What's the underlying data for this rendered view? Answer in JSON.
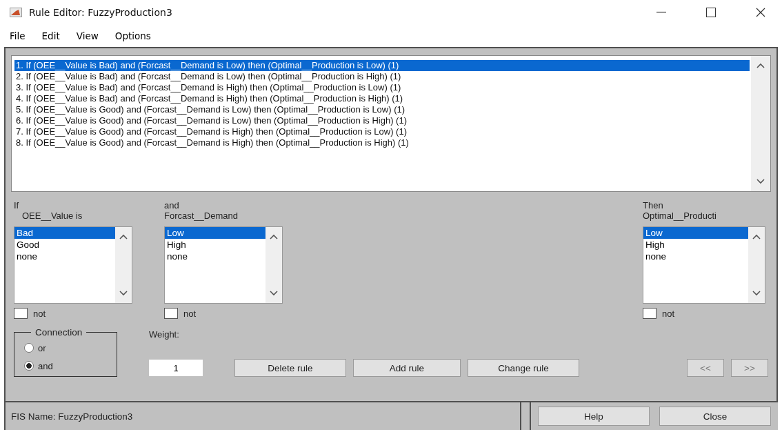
{
  "window": {
    "title": "Rule Editor: FuzzyProduction3"
  },
  "menu": [
    "File",
    "Edit",
    "View",
    "Options"
  ],
  "rules": [
    {
      "text": "1. If (OEE__Value is Bad) and (Forcast__Demand is Low) then (Optimal__Production is Low) (1)",
      "selected": true
    },
    {
      "text": "2. If (OEE__Value is Bad) and (Forcast__Demand is Low) then (Optimal__Production is High) (1)",
      "selected": false
    },
    {
      "text": "3. If (OEE__Value is Bad) and (Forcast__Demand is High) then (Optimal__Production is Low) (1)",
      "selected": false
    },
    {
      "text": "4. If (OEE__Value is Bad) and (Forcast__Demand is High) then (Optimal__Production is High) (1)",
      "selected": false
    },
    {
      "text": "5. If (OEE__Value is Good) and (Forcast__Demand is Low) then (Optimal__Production is Low) (1)",
      "selected": false
    },
    {
      "text": "6. If (OEE__Value is Good) and (Forcast__Demand is Low) then (Optimal__Production is High) (1)",
      "selected": false
    },
    {
      "text": "7. If (OEE__Value is Good) and (Forcast__Demand is High) then (Optimal__Production is Low) (1)",
      "selected": false
    },
    {
      "text": "8. If (OEE__Value is Good) and (Forcast__Demand is High) then (Optimal__Production is High) (1)",
      "selected": false
    }
  ],
  "variables": [
    {
      "connector": "If",
      "name": "OEE__Value is",
      "options": [
        {
          "label": "Bad",
          "selected": true
        },
        {
          "label": "Good",
          "selected": false
        },
        {
          "label": "none",
          "selected": false
        }
      ],
      "not_label": "not",
      "not_checked": false
    },
    {
      "connector": "and",
      "name": "Forcast__Demand",
      "options": [
        {
          "label": "Low",
          "selected": true
        },
        {
          "label": "High",
          "selected": false
        },
        {
          "label": "none",
          "selected": false
        }
      ],
      "not_label": "not",
      "not_checked": false
    },
    {
      "connector": "Then",
      "name": "Optimal__Producti",
      "options": [
        {
          "label": "Low",
          "selected": true
        },
        {
          "label": "High",
          "selected": false
        },
        {
          "label": "none",
          "selected": false
        }
      ],
      "not_label": "not",
      "not_checked": false
    }
  ],
  "connection": {
    "label": "Connection",
    "options": [
      {
        "label": "or",
        "selected": false
      },
      {
        "label": "and",
        "selected": true
      }
    ]
  },
  "weight": {
    "label": "Weight:",
    "value": "1"
  },
  "rule_buttons": [
    {
      "label": "Delete rule",
      "disabled": false
    },
    {
      "label": "Add rule",
      "disabled": false
    },
    {
      "label": "Change rule",
      "disabled": false
    }
  ],
  "nav_buttons": [
    {
      "label": "<<",
      "disabled": true
    },
    {
      "label": ">>",
      "disabled": true
    }
  ],
  "status": {
    "text": "FIS Name: FuzzyProduction3"
  },
  "footer_buttons": [
    {
      "label": "Help",
      "disabled": false
    },
    {
      "label": "Close",
      "disabled": false
    }
  ]
}
